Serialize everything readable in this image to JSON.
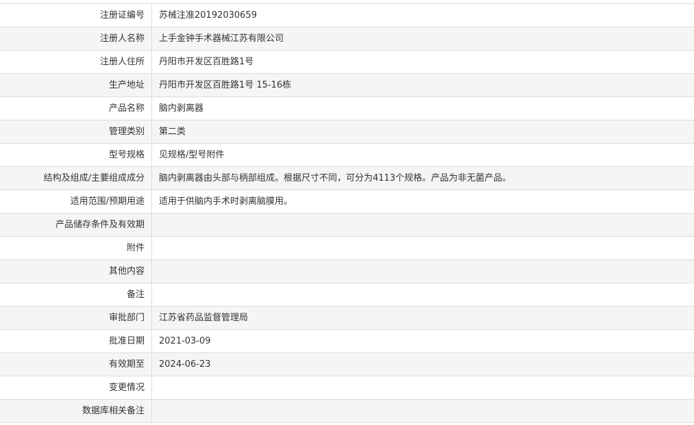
{
  "rows": [
    {
      "label": "注册证编号",
      "value": "苏械注准20192030659"
    },
    {
      "label": "注册人名称",
      "value": "上手金钟手术器械江苏有限公司"
    },
    {
      "label": "注册人住所",
      "value": "丹阳市开发区百胜路1号"
    },
    {
      "label": "生产地址",
      "value": "丹阳市开发区百胜路1号 15-16栋"
    },
    {
      "label": "产品名称",
      "value": "脑内剥离器"
    },
    {
      "label": "管理类别",
      "value": "第二类"
    },
    {
      "label": "型号规格",
      "value": "见规格/型号附件"
    },
    {
      "label": "结构及组成/主要组成成分",
      "value": "脑内剥离器由头部与柄部组成。根据尺寸不同，可分为4113个规格。产品为非无菌产品。"
    },
    {
      "label": "适用范围/预期用途",
      "value": "适用于供脑内手术时剥离脑膜用。"
    },
    {
      "label": "产品储存条件及有效期",
      "value": ""
    },
    {
      "label": "附件",
      "value": ""
    },
    {
      "label": "其他内容",
      "value": ""
    },
    {
      "label": "备注",
      "value": ""
    },
    {
      "label": "审批部门",
      "value": "江苏省药品监督管理局"
    },
    {
      "label": "批准日期",
      "value": "2021-03-09"
    },
    {
      "label": "有效期至",
      "value": "2024-06-23"
    },
    {
      "label": "变更情况",
      "value": ""
    },
    {
      "label": "数据库相关备注",
      "value": ""
    }
  ]
}
